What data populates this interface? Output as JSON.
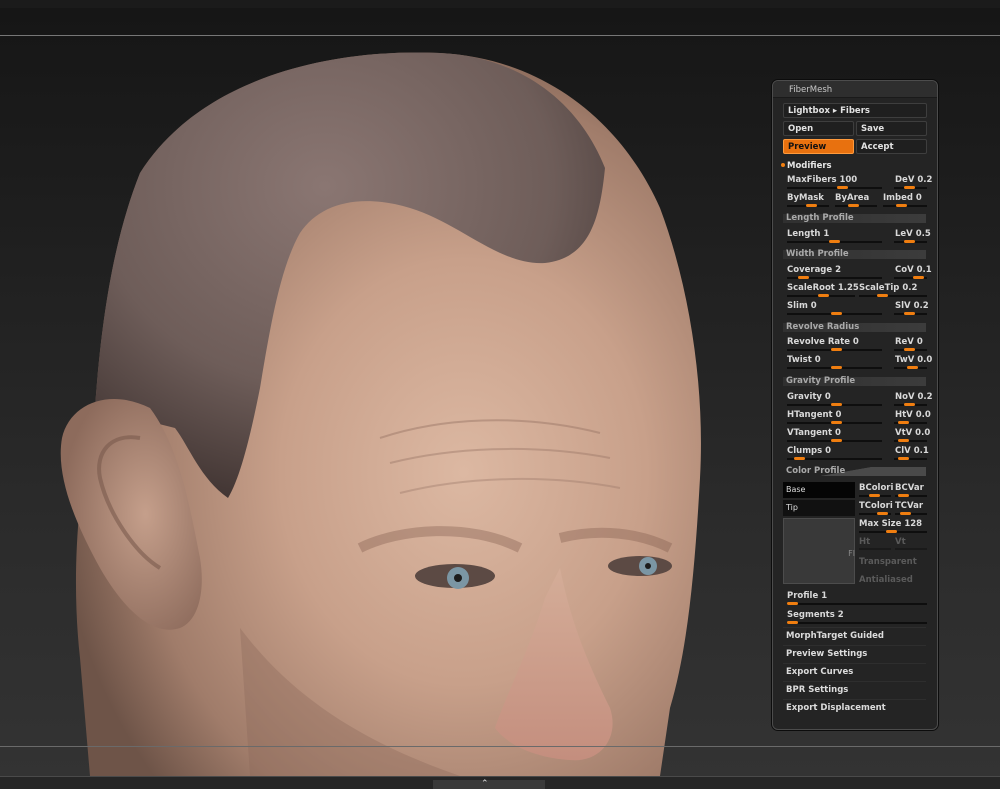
{
  "panel": {
    "title": "FiberMesh",
    "lightbox": "Lightbox ▸ Fibers",
    "open": "Open",
    "save": "Save",
    "preview": "Preview",
    "accept": "Accept",
    "modifiers": "Modifiers",
    "rows": [
      {
        "l": "MaxFibers 100",
        "r": "DeV 0.2",
        "ratio_l": 0.45,
        "ratio_r": 0.5
      },
      {
        "l": "ByMask",
        "m": "ByArea",
        "r": "Imbed 0",
        "ratio_l": 0.6,
        "ratio_m": 0.35,
        "ratio_r": 0.4
      }
    ],
    "length_profile": "Length Profile",
    "length": "Length 1",
    "lev": "LeV 0.5",
    "width_profile": "Width Profile",
    "coverage": "Coverage 2",
    "cov": "CoV 0.1",
    "scaleroot": "ScaleRoot 1.25",
    "scaletip": "ScaleTip 0.2",
    "slim": "Slim 0",
    "slv": "SlV 0.2",
    "revolve_radius": "Revolve Radius",
    "revolve_rate": "Revolve Rate 0",
    "rev": "ReV 0",
    "twist": "Twist 0",
    "twv": "TwV 0.0",
    "gravity_profile": "Gravity Profile",
    "gravity": "Gravity 0",
    "nov": "NoV 0.2",
    "htangent": "HTangent 0",
    "htv": "HtV 0.0",
    "vtangent": "VTangent 0",
    "vtv": "VtV 0.0",
    "clumps": "Clumps 0",
    "clv": "ClV 0.1",
    "color_profile": "Color Profile",
    "base": "Base",
    "tip": "Tip",
    "bcolori": "BColori",
    "bcvar": "BCVar",
    "tcolori": "TColori",
    "tcvar": "TCVar",
    "max_size": "Max Size 128",
    "ht": "Ht",
    "vt": "Vt",
    "fl": "Fl",
    "transparent": "Transparent",
    "antialiased": "Antialiased",
    "profile": "Profile 1",
    "segments": "Segments 2",
    "morph": "MorphTarget Guided",
    "preview_settings": "Preview Settings",
    "export_curves": "Export Curves",
    "bpr_settings": "BPR Settings",
    "export_displacement": "Export Displacement"
  },
  "colors": {
    "accent": "#f07e10",
    "panel_bg": "#242424"
  }
}
